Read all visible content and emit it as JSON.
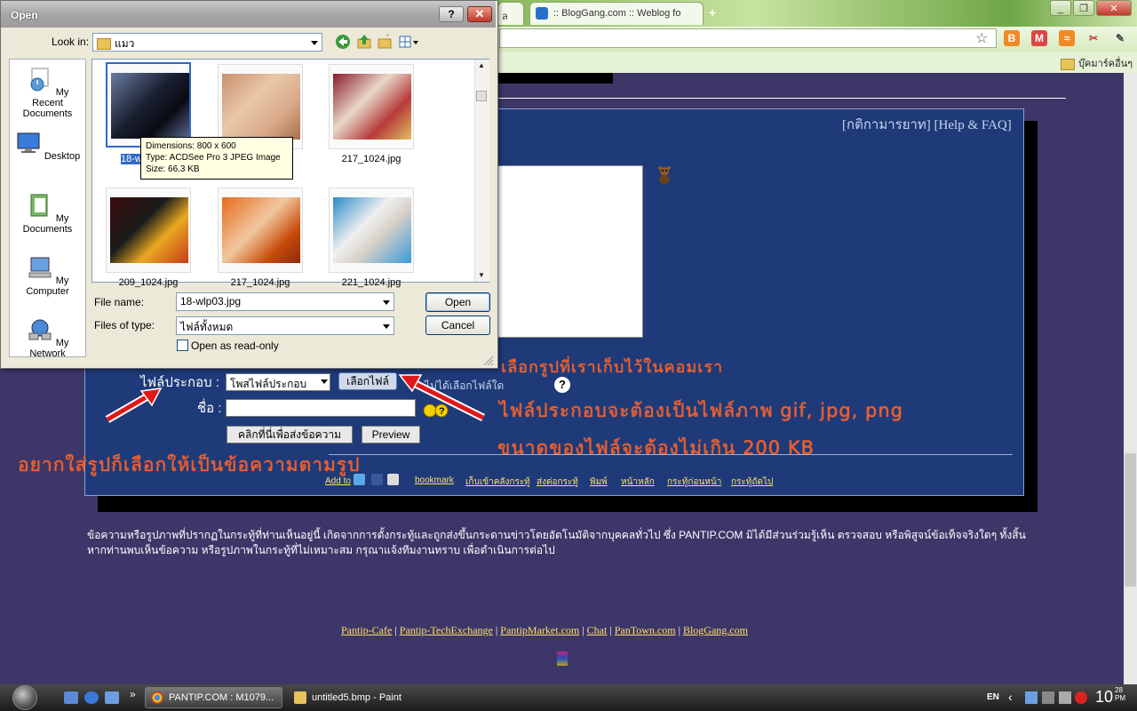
{
  "browser": {
    "tabs": [
      {
        "label": "ล"
      },
      {
        "label": ":: BlogGang.com :: Weblog fo"
      }
    ],
    "new_tab": "+",
    "window_buttons": [
      "_",
      "❐",
      "✕"
    ],
    "bookmarks_bar": {
      "other_label": "บุ๊คมาร์คอื่นๆ"
    }
  },
  "page": {
    "help_links": "[กติกามารยาท] [Help & FAQ]",
    "attach_label": "ไฟล์ประกอบ :",
    "attach_select_value": "โพสไฟล์ประกอบ",
    "choose_file_label": "เลือกไฟล์",
    "choose_file_hint": "ไม่ได้เลือกไฟล์ใด",
    "help_mark": "?",
    "name_label": "ชื่อ :",
    "send_label": "คลิกที่นี่เพื่อส่งข้อความ",
    "preview_label": "Preview",
    "addto_label": "Add to",
    "footer_nav": [
      "bookmark",
      "เก็บเข้าคลังกระทู้",
      "ส่งต่อกระทู้",
      "พิมพ์",
      "หน้าหลัก",
      "กระทู้ก่อนหน้า",
      "กระทู้ถัดไป"
    ],
    "disclaimer": "ข้อความหรือรูปภาพที่ปรากฏในกระทู้ที่ท่านเห็นอยู่นี้ เกิดจากการตั้งกระทู้และถูกส่งขึ้นกระดานข่าวโดยอัตโนมัติจากบุคคลทั่วไป ซึ่ง PANTIP.COM มิได้มีส่วนร่วมรู้เห็น ตรวจสอบ หรือพิสูจน์ข้อเท็จจริงใดๆ ทั้งสิ้น หากท่านพบเห็นข้อความ หรือรูปภาพในกระทู้ที่ไม่เหมาะสม กรุณาแจ้งทีมงานทราบ เพื่อดำเนินการต่อไป",
    "site_links": [
      "Pantip-Cafe",
      "Pantip-TechExchange",
      "PantipMarket.com",
      "Chat",
      "PanTown.com",
      "BlogGang.com"
    ],
    "annotations": [
      "เลือกรูปที่เราเก็บไว้ในคอมเรา",
      "ไฟล์ประกอบจะต้องเป็นไฟล์ภาพ gif, jpg, png",
      "ขนาดของไฟล์จะต้องไม่เกิน 200 KB",
      "อยากใส่รูปก็เลือกให้เป็นข้อความตามรูป"
    ]
  },
  "dialog": {
    "title": "Open",
    "help_btn": "?",
    "close_btn": "✕",
    "lookin_label": "Look in:",
    "lookin_value": "แมว",
    "places": [
      "My Recent Documents",
      "Desktop",
      "My Documents",
      "My Computer",
      "My Network"
    ],
    "files": [
      {
        "name": "18-w",
        "selected": true
      },
      {
        "name": "",
        "selected": false
      },
      {
        "name": "217_1024.jpg",
        "selected": false
      },
      {
        "name": "209_1024.jpg",
        "selected": false
      },
      {
        "name": "217_1024.jpg",
        "selected": false
      },
      {
        "name": "221_1024.jpg",
        "selected": false
      }
    ],
    "tooltip": {
      "dimensions": "Dimensions: 800 x 600",
      "type": "Type: ACDSee Pro 3 JPEG Image",
      "size": "Size: 66.3 KB"
    },
    "file_name_label": "File name:",
    "file_name_value": "18-wlp03.jpg",
    "file_type_label": "Files of type:",
    "file_type_value": "ไฟล์ทั้งหมด",
    "open_label": "Open",
    "cancel_label": "Cancel",
    "readonly_label": "Open as read-only"
  },
  "taskbar": {
    "tasks": [
      {
        "label": "PANTIP.COM : M1079..."
      },
      {
        "label": "untitled5.bmp - Paint"
      }
    ],
    "lang": "EN",
    "clock": "10",
    "clock_small_top": "28",
    "clock_small_bottom": "PM"
  },
  "colors": {
    "page_bg": "#3d3668",
    "panel_bg": "#1e3a78",
    "annotation": "#ff5a1e",
    "link": "#ffe066"
  }
}
